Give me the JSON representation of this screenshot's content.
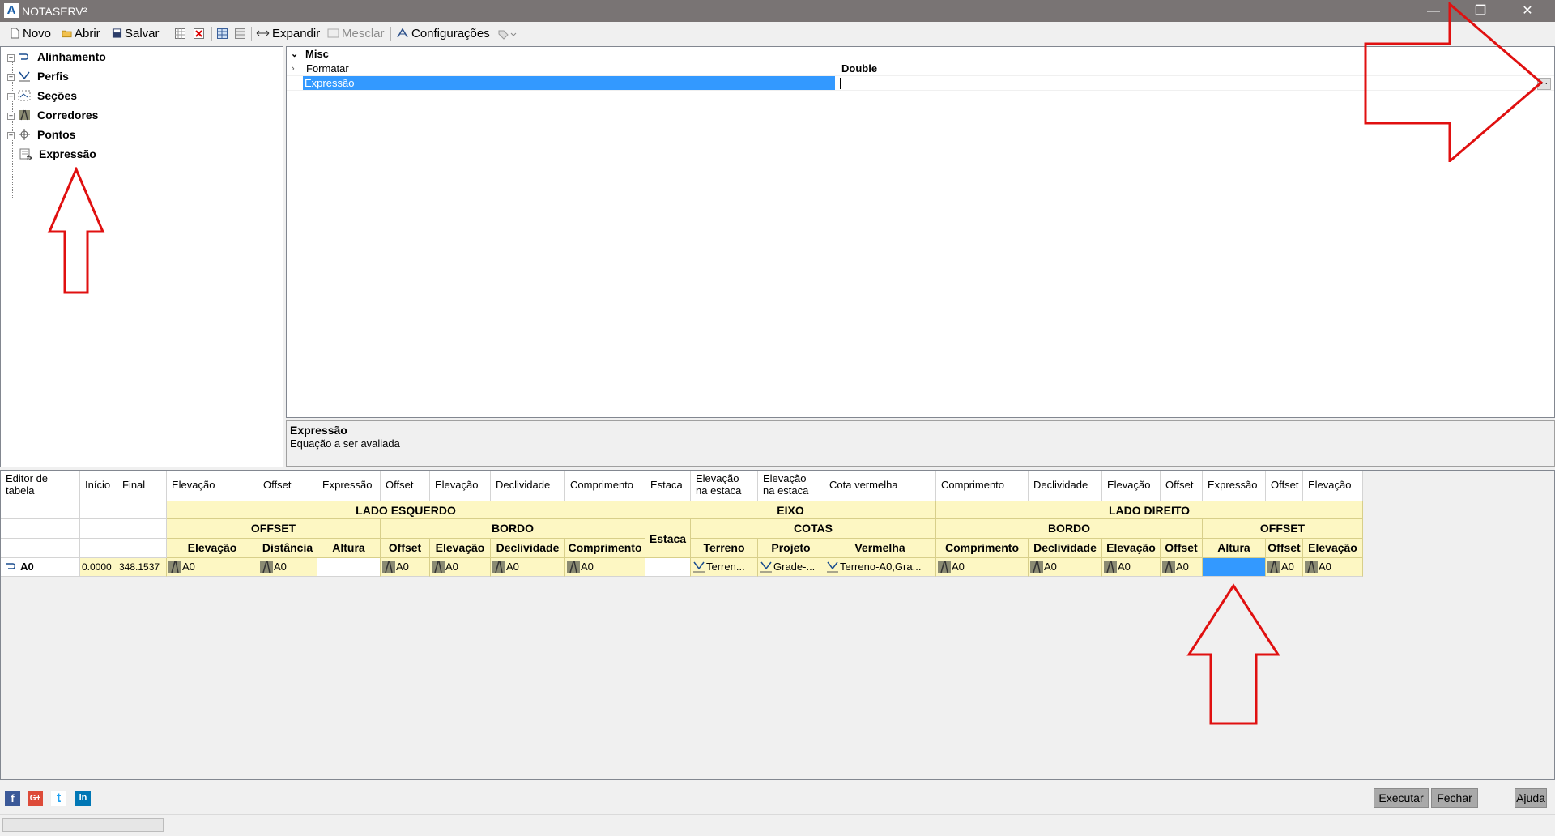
{
  "window": {
    "title": "NOTASERV²",
    "minimize": "—",
    "restore": "❐",
    "close": "✕"
  },
  "toolbar": {
    "novo": "Novo",
    "abrir": "Abrir",
    "salvar": "Salvar",
    "expandir": "Expandir",
    "mesclar": "Mesclar",
    "configuracoes": "Configurações"
  },
  "tree": {
    "items": [
      {
        "label": "Alinhamento"
      },
      {
        "label": "Perfis"
      },
      {
        "label": "Seções"
      },
      {
        "label": "Corredores"
      },
      {
        "label": "Pontos"
      },
      {
        "label": "Expressão"
      }
    ]
  },
  "properties": {
    "category": "Misc",
    "rows": [
      {
        "name": "Formatar",
        "value": "Double"
      },
      {
        "name": "Expressão",
        "value": ""
      }
    ],
    "ellipsis": "..."
  },
  "help": {
    "title": "Expressão",
    "description": "Equação a ser avaliada"
  },
  "grid": {
    "columns": [
      "Editor de tabela",
      "Início",
      "Final",
      "Elevação",
      "Offset",
      "Expressão",
      "Offset",
      "Elevação",
      "Declividade",
      "Comprimento",
      "Estaca",
      "Elevação na estaca",
      "Elevação na estaca",
      "Cota vermelha",
      "Comprimento",
      "Declividade",
      "Elevação",
      "Offset",
      "Expressão",
      "Offset",
      "Elevação"
    ],
    "bands": {
      "left": "LADO ESQUERDO",
      "center": "EIXO",
      "right": "LADO DIREITO"
    },
    "subbands": {
      "left_offset": "OFFSET",
      "left_bordo": "BORDO",
      "estaca": "Estaca",
      "cotas": "COTAS",
      "right_bordo": "BORDO",
      "right_offset": "OFFSET"
    },
    "subheaders": [
      "Elevação",
      "Distância",
      "Altura",
      "Offset",
      "Elevação",
      "Declividade",
      "Comprimento",
      "Terreno",
      "Projeto",
      "Vermelha",
      "Comprimento",
      "Declividade",
      "Elevação",
      "Offset",
      "Altura",
      "Offset",
      "Elevação"
    ],
    "row": {
      "name": "A0",
      "inicio": "0.0000",
      "final": "348.1537",
      "cells": [
        "A0",
        "A0",
        "",
        "A0",
        "A0",
        "A0",
        "A0",
        "",
        "Terren...",
        "Grade-...",
        "Terreno-A0,Gra...",
        "A0",
        "A0",
        "A0",
        "A0",
        "",
        "A0",
        "A0"
      ]
    }
  },
  "footer": {
    "social": [
      "f",
      "G+",
      "t",
      "in"
    ],
    "executar": "Executar",
    "fechar": "Fechar",
    "ajuda": "Ajuda"
  },
  "colors": {
    "titlebar": "#797474",
    "selection": "#3399ff",
    "band": "#fdf7c3",
    "arrow": "#e01010"
  }
}
